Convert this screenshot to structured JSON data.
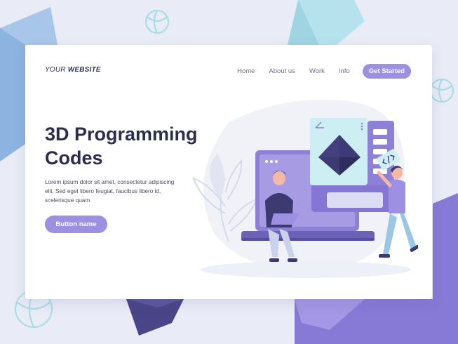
{
  "logo": {
    "prefix": "YOUR",
    "suffix": "WEBSITE"
  },
  "nav": {
    "links": [
      "Home",
      "About us",
      "Work",
      "Info"
    ],
    "cta": "Get Started"
  },
  "hero": {
    "title_line1": "3D Programming",
    "title_line2": "Codes",
    "text": "Lorem ipsum dolor sit amet, consectetur adipiscing elit. Sed eget libero feugiat, faucibus libero id, scelerisque quam",
    "button": "Button name"
  },
  "colors": {
    "background": "#e9ecf6",
    "accent": "#9d8fe2",
    "heading": "#2d2d4f",
    "deep_purple": "#4a4488",
    "pale_blue": "#cdeff3"
  },
  "icons": [
    "code-tag-icon",
    "pyramid-icon",
    "sphere-icon"
  ]
}
